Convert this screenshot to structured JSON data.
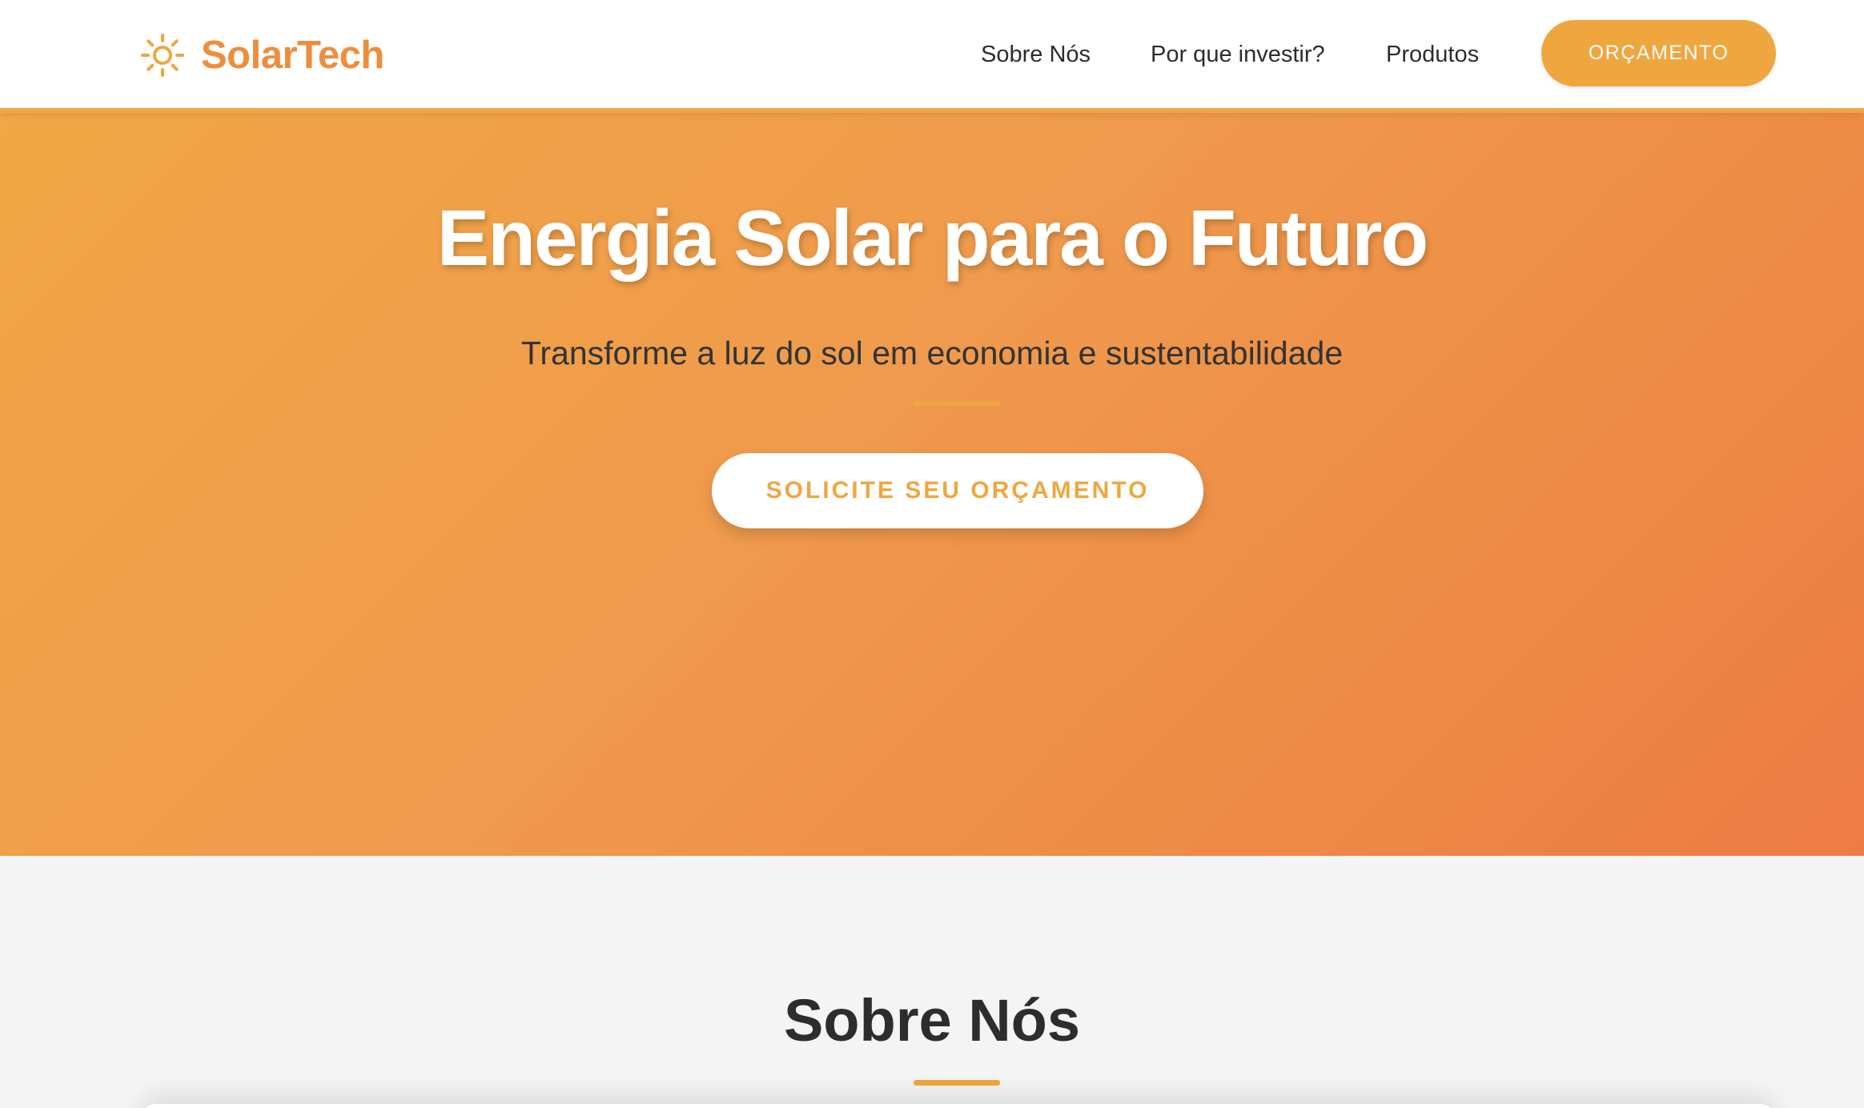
{
  "brand": {
    "name": "SolarTech",
    "icon": "sun-icon",
    "color": "#ee8d3c"
  },
  "nav": {
    "items": [
      {
        "label": "Sobre Nós"
      },
      {
        "label": "Por que investir?"
      },
      {
        "label": "Produtos"
      }
    ],
    "cta_label": "ORÇAMENTO"
  },
  "hero": {
    "title": "Energia Solar para o Futuro",
    "subtitle": "Transforme a luz do sol em economia e sustentabilidade",
    "cta_label": "SOLICITE SEU ORÇAMENTO"
  },
  "about": {
    "title": "Sobre Nós"
  },
  "colors": {
    "accent": "#f0a63f",
    "hero_gradient_start": "#f1a745",
    "hero_gradient_end": "#ed7b45",
    "text_dark": "#2d2d2d"
  }
}
